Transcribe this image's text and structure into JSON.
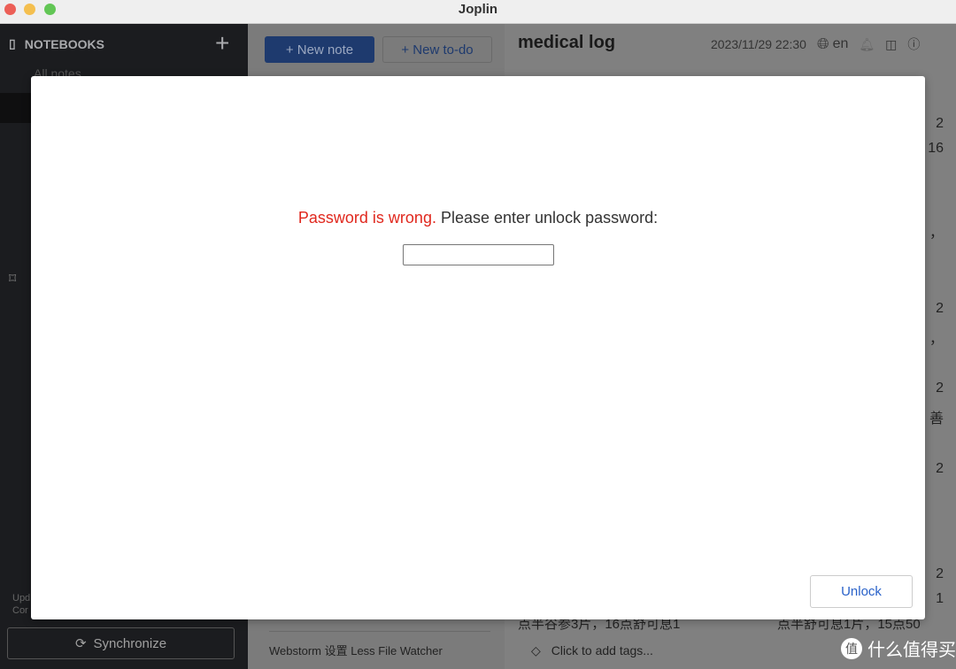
{
  "window": {
    "title": "Joplin"
  },
  "sidebar": {
    "header": "NOTEBOOKS",
    "all_notes": "All notes",
    "status_lines": [
      "Upd",
      "Cor"
    ],
    "sync_label": "Synchronize"
  },
  "note_list": {
    "new_note": "New note",
    "new_todo": "New to-do",
    "items": [
      "Webstorm 设置 Less File Watcher"
    ]
  },
  "editor": {
    "title": "medical log",
    "date": "2023/11/29 22:30",
    "language": "en",
    "line_left": "点半谷参3片，16点舒可息1",
    "line_right": "点半舒可息1片，15点50",
    "tags_placeholder": "Click to add tags...",
    "fragments": [
      "2",
      "16",
      "，",
      "2",
      "，",
      "2",
      "善",
      "2",
      "2",
      "1"
    ]
  },
  "modal": {
    "error_text": "Password is wrong.",
    "prompt_text": "Please enter unlock password:",
    "password_value": "",
    "unlock_label": "Unlock"
  },
  "watermark": {
    "text": "什么值得买",
    "logo": "值"
  },
  "colors": {
    "error": "#e0281e",
    "accent": "#2a62c9",
    "new_note_bg": "#1e3a6e"
  }
}
